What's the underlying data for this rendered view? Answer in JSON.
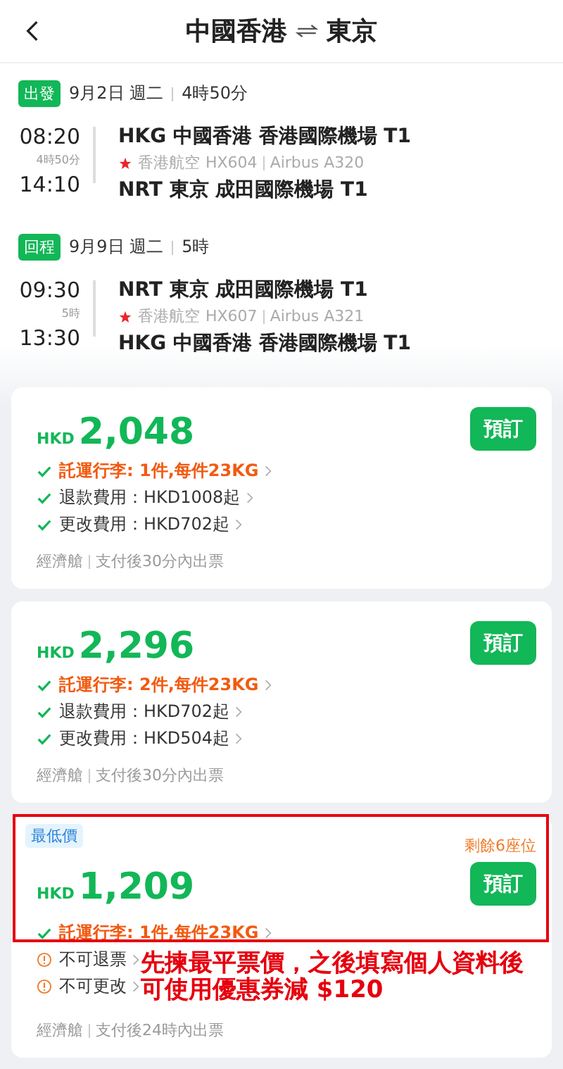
{
  "header": {
    "origin": "中國香港",
    "destination": "東京"
  },
  "segments": [
    {
      "tag": "出發",
      "date": "9月2日 週二",
      "duration": "4時50分",
      "dep_time": "08:20",
      "leg_duration": "4時50分",
      "arr_time": "14:10",
      "dep_airport": "HKG 中國香港 香港國際機場 T1",
      "airline": "香港航空",
      "flight": "HX604",
      "aircraft": "Airbus A320",
      "arr_airport": "NRT 東京 成田國際機場 T1"
    },
    {
      "tag": "回程",
      "date": "9月9日 週二",
      "duration": "5時",
      "dep_time": "09:30",
      "leg_duration": "5時",
      "arr_time": "13:30",
      "dep_airport": "NRT 東京 成田國際機場 T1",
      "airline": "香港航空",
      "flight": "HX607",
      "aircraft": "Airbus A321",
      "arr_airport": "HKG 中國香港 香港國際機場 T1"
    }
  ],
  "fares": [
    {
      "currency": "HKD",
      "price": "2,048",
      "button": "預訂",
      "conditions": [
        {
          "kind": "included",
          "text": "託運行李: 1件,每件23KG",
          "highlight": true
        },
        {
          "kind": "included",
          "text": "退款費用：HKD1008起",
          "highlight": false
        },
        {
          "kind": "included",
          "text": "更改費用：HKD702起",
          "highlight": false
        }
      ],
      "cabin": "經濟艙",
      "ticketing": "支付後30分內出票"
    },
    {
      "currency": "HKD",
      "price": "2,296",
      "button": "預訂",
      "conditions": [
        {
          "kind": "included",
          "text": "託運行李: 2件,每件23KG",
          "highlight": true
        },
        {
          "kind": "included",
          "text": "退款費用：HKD702起",
          "highlight": false
        },
        {
          "kind": "included",
          "text": "更改費用：HKD504起",
          "highlight": false
        }
      ],
      "cabin": "經濟艙",
      "ticketing": "支付後30分內出票"
    },
    {
      "badge": "最低價",
      "seats": "剩餘6座位",
      "currency": "HKD",
      "price": "1,209",
      "button": "預訂",
      "conditions": [
        {
          "kind": "included",
          "text": "託運行李: 1件,每件23KG",
          "highlight": true
        },
        {
          "kind": "warning",
          "text": "不可退票",
          "highlight": false
        },
        {
          "kind": "warning",
          "text": "不可更改",
          "highlight": false
        }
      ],
      "cabin": "經濟艙",
      "ticketing": "支付後24時內出票",
      "annotation": {
        "lines": [
          "先揀最平票價，之後填寫個人資料後",
          "可使用優惠券減 $120"
        ]
      }
    }
  ]
}
